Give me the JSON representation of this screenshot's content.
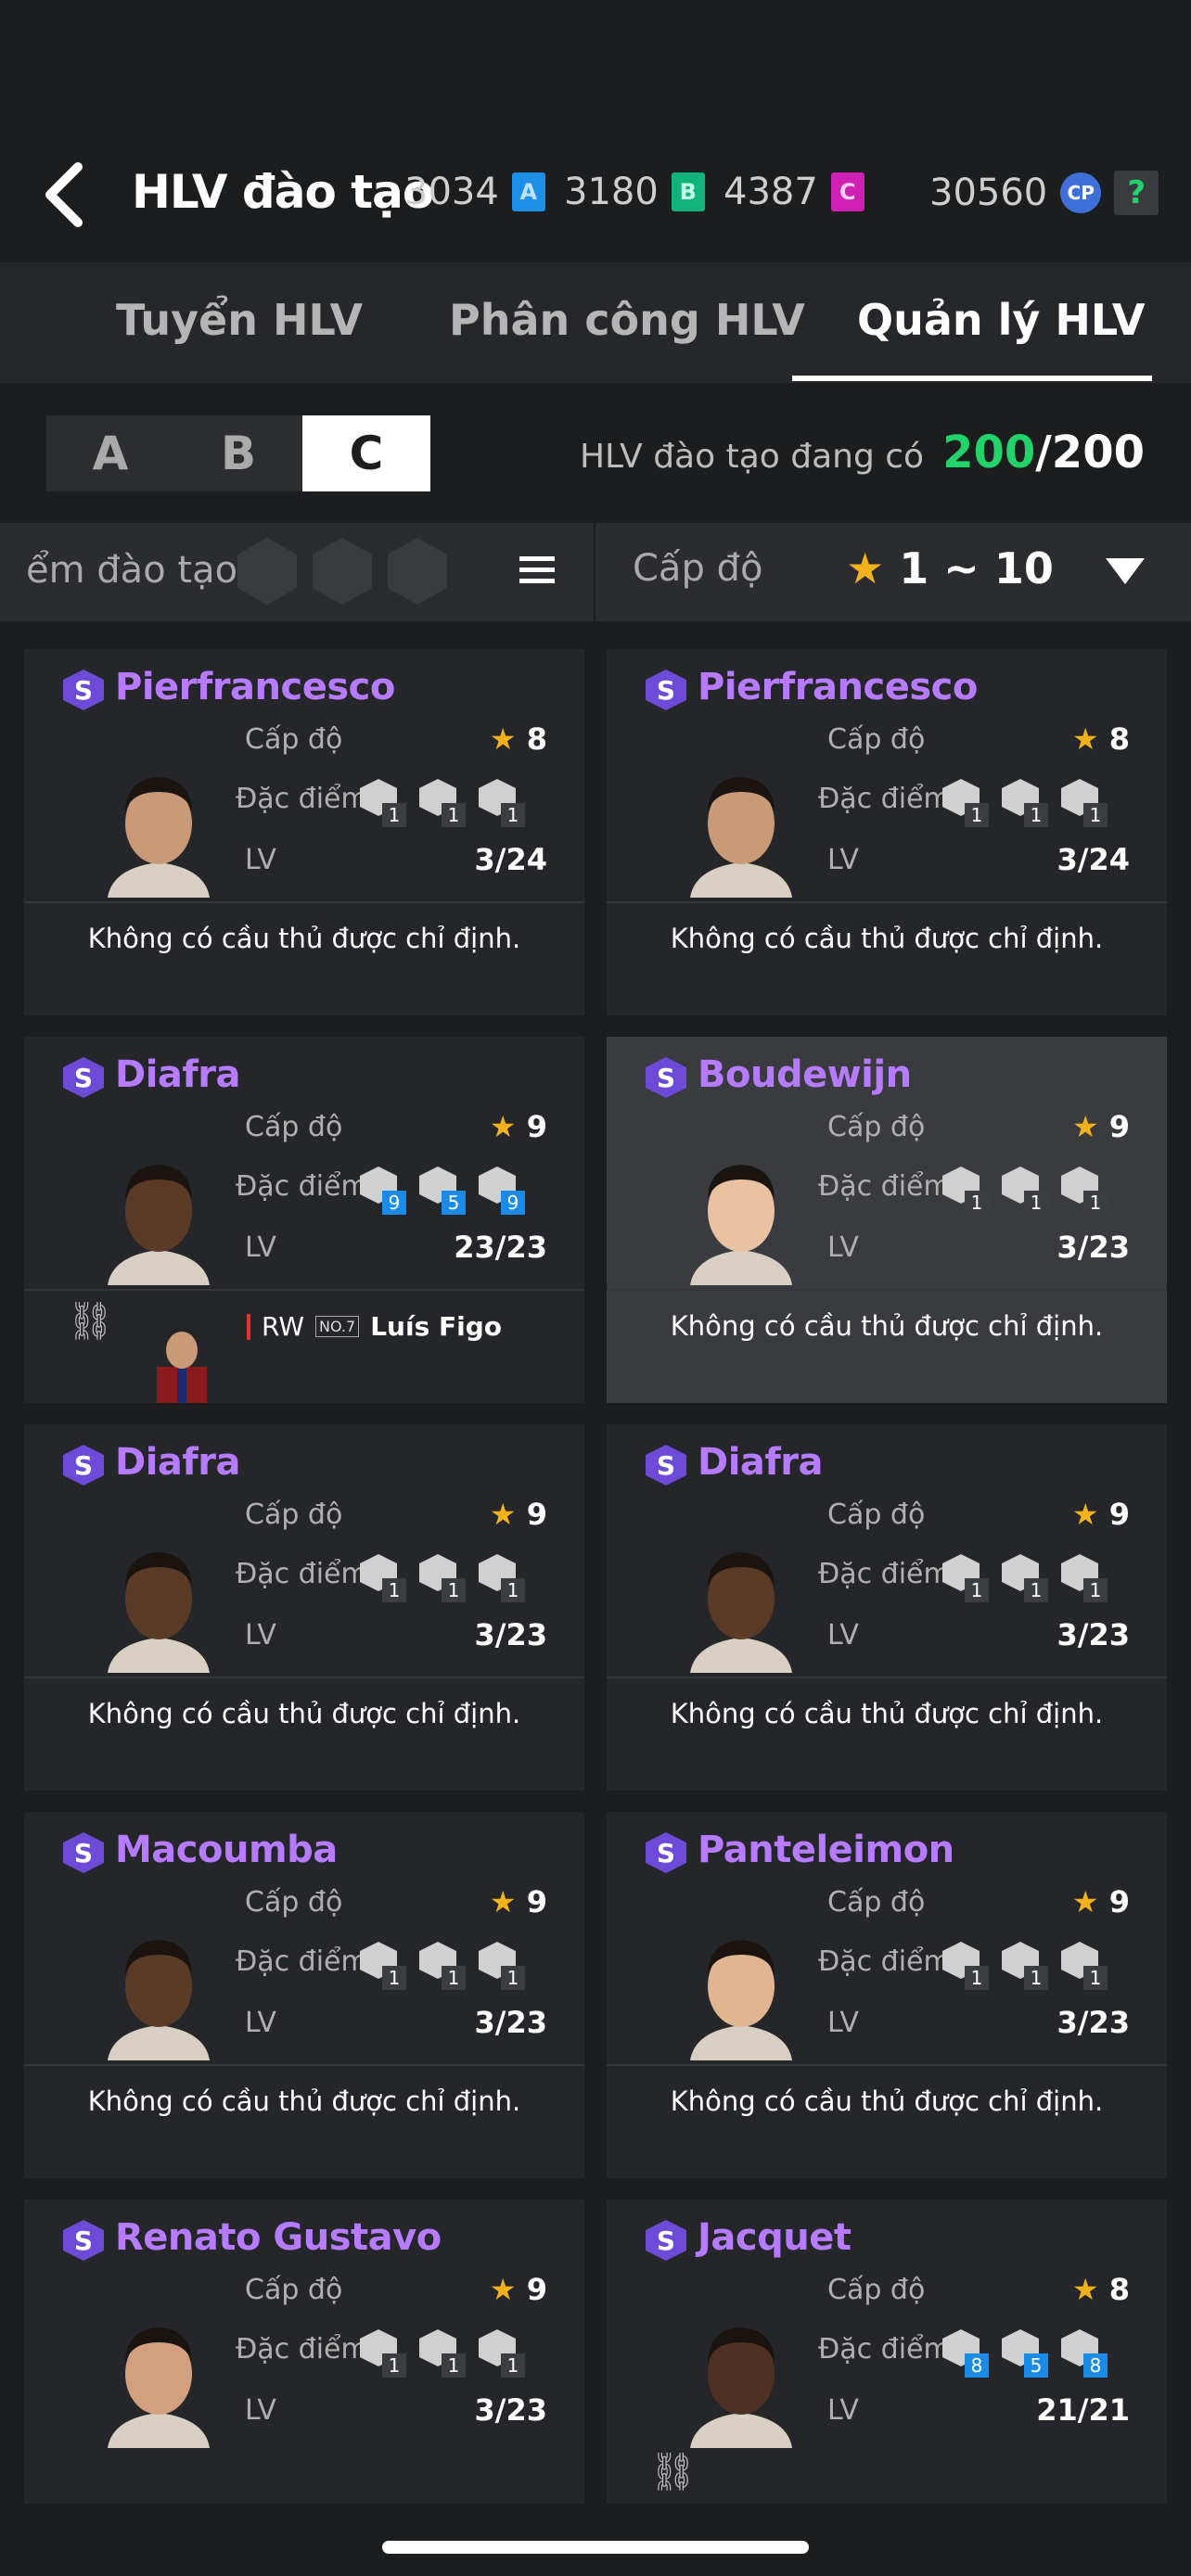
{
  "header": {
    "title": "HLV đào tạo",
    "currencies": [
      {
        "value": "3034",
        "badge": "A",
        "color": "#1e8fe6"
      },
      {
        "value": "3180",
        "badge": "B",
        "color": "#12b37a"
      },
      {
        "value": "4387",
        "badge": "C",
        "color": "#d01fb4"
      }
    ],
    "points": "30560",
    "points_badge": "CP",
    "help": "?"
  },
  "tabs": [
    {
      "label": "Tuyển HLV"
    },
    {
      "label": "Phân công HLV"
    },
    {
      "label": "Quản lý HLV"
    }
  ],
  "segments": [
    "A",
    "B",
    "C"
  ],
  "count": {
    "label": "HLV đào tạo đang có",
    "current": "200",
    "max": "/200"
  },
  "filter": {
    "traits_label": "ểm đào tạo",
    "level_label": "Cấp độ",
    "level_range": "1 ~ 10"
  },
  "labels": {
    "level": "Cấp độ",
    "traits": "Đặc điểm",
    "lv": "LV",
    "none": "Không có cầu thủ được chỉ định."
  },
  "cards": [
    {
      "name": "Pierfrancesco",
      "level": "8",
      "lv": "3/24",
      "traits": [
        "1",
        "1",
        "1"
      ],
      "blue": false,
      "skin": "#c99a78"
    },
    {
      "name": "Pierfrancesco",
      "level": "8",
      "lv": "3/24",
      "traits": [
        "1",
        "1",
        "1"
      ],
      "blue": false,
      "skin": "#c99a78"
    },
    {
      "name": "Diafra",
      "level": "9",
      "lv": "23/23",
      "traits": [
        "9",
        "5",
        "9"
      ],
      "blue": true,
      "skin": "#5a3b28",
      "assigned": {
        "pos": "RW",
        "player": "Luís Figo",
        "tag": "NO.7"
      }
    },
    {
      "name": "Boudewijn",
      "level": "9",
      "lv": "3/23",
      "traits": [
        "1",
        "1",
        "1"
      ],
      "blue": false,
      "skin": "#e9c2a2",
      "highlight": true
    },
    {
      "name": "Diafra",
      "level": "9",
      "lv": "3/23",
      "traits": [
        "1",
        "1",
        "1"
      ],
      "blue": false,
      "skin": "#5a3b28"
    },
    {
      "name": "Diafra",
      "level": "9",
      "lv": "3/23",
      "traits": [
        "1",
        "1",
        "1"
      ],
      "blue": false,
      "skin": "#5a3b28"
    },
    {
      "name": "Macoumba",
      "level": "9",
      "lv": "3/23",
      "traits": [
        "1",
        "1",
        "1"
      ],
      "blue": false,
      "skin": "#5a3b28"
    },
    {
      "name": "Panteleimon",
      "level": "9",
      "lv": "3/23",
      "traits": [
        "1",
        "1",
        "1"
      ],
      "blue": false,
      "skin": "#e0b592"
    },
    {
      "name": "Renato Gustavo",
      "level": "9",
      "lv": "3/23",
      "traits": [
        "1",
        "1",
        "1"
      ],
      "blue": false,
      "skin": "#d2a07e"
    },
    {
      "name": "Jacquet",
      "level": "8",
      "lv": "21/21",
      "traits": [
        "8",
        "5",
        "8"
      ],
      "blue": true,
      "skin": "#4d3122",
      "linked": true
    }
  ]
}
